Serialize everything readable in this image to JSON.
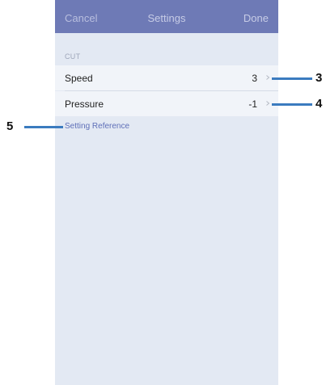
{
  "navbar": {
    "cancel_label": "Cancel",
    "title": "Settings",
    "done_label": "Done"
  },
  "section": {
    "header": "CUT"
  },
  "rows": [
    {
      "label": "Speed",
      "value": "3"
    },
    {
      "label": "Pressure",
      "value": "-1"
    }
  ],
  "reference_link": "Setting Reference",
  "callouts": [
    "3",
    "4",
    "5"
  ],
  "colors": {
    "navbar_bg": "#6e7ab6",
    "screen_bg": "#e3e9f3",
    "row_bg": "#f1f4f9",
    "link": "#5e6fb8",
    "callout_line": "#3b7bbf"
  },
  "icons": {
    "row_disclosure": "chevron-right-icon"
  }
}
